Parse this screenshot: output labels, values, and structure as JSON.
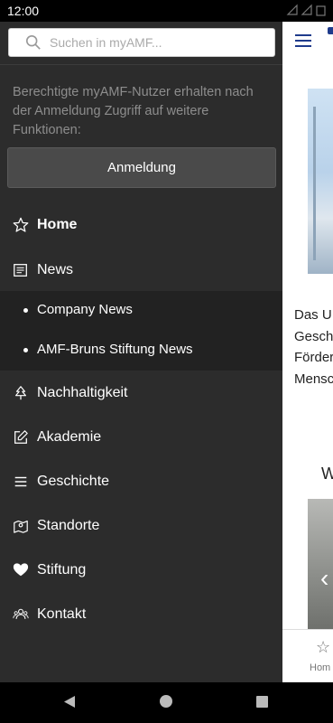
{
  "status_bar": {
    "time": "12:00"
  },
  "drawer": {
    "search": {
      "placeholder": "Suchen in myAMF..."
    },
    "info_text": "Berechtigte myAMF-Nutzer erhalten nach der Anmeldung Zugriff auf weitere Funktionen:",
    "login_label": "Anmeldung",
    "nav": {
      "home": {
        "label": "Home",
        "icon": "star-icon"
      },
      "news": {
        "label": "News",
        "icon": "newspaper-icon"
      },
      "news_sub": [
        {
          "label": "Company News"
        },
        {
          "label": "AMF-Bruns Stiftung News"
        }
      ],
      "nachhaltigkeit": {
        "label": "Nachhaltigkeit",
        "icon": "tree-icon"
      },
      "akademie": {
        "label": "Akademie",
        "icon": "edit-icon"
      },
      "geschichte": {
        "label": "Geschichte",
        "icon": "list-icon"
      },
      "standorte": {
        "label": "Standorte",
        "icon": "map-pin-icon"
      },
      "stiftung": {
        "label": "Stiftung",
        "icon": "heart-icon"
      },
      "kontakt": {
        "label": "Kontakt",
        "icon": "people-icon"
      }
    }
  },
  "background_app": {
    "text_lines": [
      "Das U",
      "Gesch",
      "Förder",
      "Mensc"
    ],
    "heading": "W",
    "tab_label": "Hom"
  },
  "colors": {
    "drawer_bg": "#2c2c2c",
    "submenu_bg": "#222222",
    "accent": "#1f3b8c"
  }
}
